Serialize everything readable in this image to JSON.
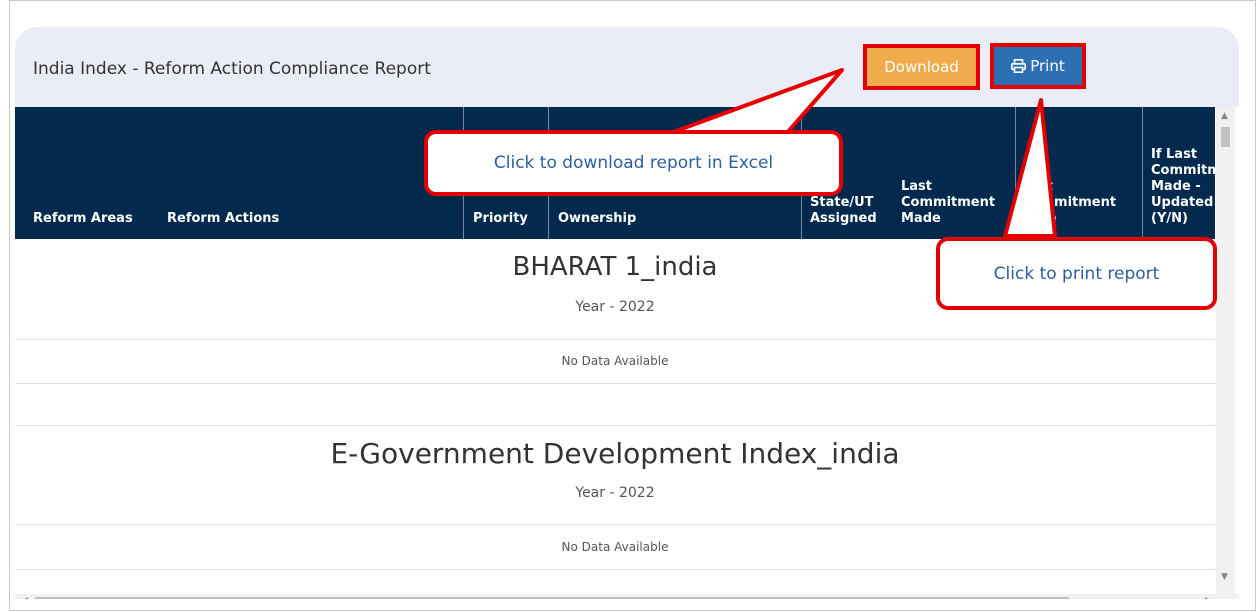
{
  "report": {
    "title": "India Index - Reform Action Compliance Report",
    "download_label": "Download",
    "print_label": "Print",
    "print_icon": "printer-icon"
  },
  "table": {
    "headers": [
      "Reform Areas",
      "Reform Actions",
      "Priority",
      "Ownership",
      "State/UT Assigned",
      "Last Commitment Made",
      "Last Commitment Date",
      "If Last Commitment Made - Updated (Y/N)"
    ]
  },
  "groups": [
    {
      "name": "BHARAT 1_india",
      "year": "Year - 2022",
      "status": "No Data Available"
    },
    {
      "name": "E-Government Development Index_india",
      "year": "Year - 2022",
      "status": "No Data Available"
    }
  ],
  "callouts": {
    "download": "Click to download  report in Excel",
    "print": "Click to print report"
  },
  "colors": {
    "header_bg": "#03294d",
    "download_btn": "#f0ac4c",
    "print_btn": "#2c6fb2",
    "callout_border": "#e40000",
    "callout_text": "#2c5f9e"
  }
}
